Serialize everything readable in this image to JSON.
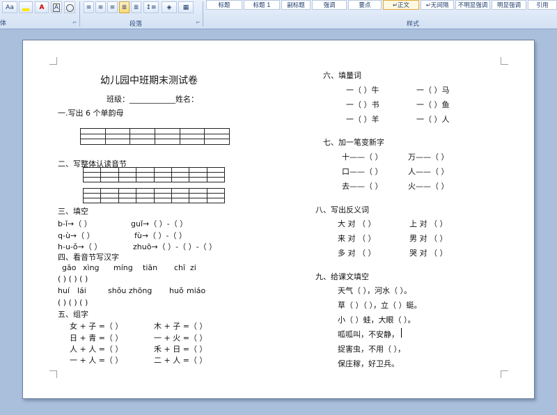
{
  "ribbon": {
    "font_size_btn": "Aa",
    "char_border": "A",
    "phonetic": "变",
    "paragraph_group": "段落",
    "styles_group": "样式",
    "font_group_tail": "体",
    "styles": [
      "标题",
      "标题 1",
      "副标题",
      "强调",
      "要点",
      "↵正文",
      "↵无间隔",
      "不明显强调",
      "明显强调",
      "引用"
    ]
  },
  "doc": {
    "title": "幼儿园中班期末测试卷",
    "class_line": "班级：____________姓名：",
    "s1": "一.写出 6 个单韵母",
    "s2": "二、写整体认读音节",
    "s3": "三、填空",
    "s3_rows": [
      [
        "b-ǐ→（          ）",
        "guǐ→（       ）-（     ）"
      ],
      [
        "q-ù→（          ）",
        "fù→（       ）-（      ）"
      ],
      [
        "h-u-ǒ→（        ）",
        "zhuō→（       ）-（     ）-（      ）"
      ]
    ],
    "s4": "四、看音节写汉字",
    "s4_py1": [
      "gāo",
      "xìng",
      "míng",
      "tiān",
      "chī",
      "zi"
    ],
    "s4_br1": "(                  )          (                 )         (                )",
    "s4_py2": [
      "huí",
      "lái",
      "shǒu zhōng",
      "huǒ",
      "miáo"
    ],
    "s4_br2": "(                 ) (                 )        (                 )",
    "s5": "五、组字",
    "s5_rows": [
      [
        "女 + 子 =（    ）",
        "木 + 子 =（    ）"
      ],
      [
        "日 + 青 =（    ）",
        "一 + 火 =（    ）"
      ],
      [
        "人 + 人 =（    ）",
        "禾 + 日 =（    ）"
      ],
      [
        "一 + 人 =（    ）",
        "二 + 人 =（    ）"
      ]
    ],
    "s6": "六、填量词",
    "s6_rows": [
      [
        "一（     ）牛",
        "一（     ）马"
      ],
      [
        "一（     ）书",
        "一（     ）鱼"
      ],
      [
        "一（     ）羊",
        "一（     ）人"
      ]
    ],
    "s7": "七、加一笔变新字",
    "s7_rows": [
      [
        "十——（     ）",
        "万——（     ）"
      ],
      [
        "口——（     ）",
        "人——（     ）"
      ],
      [
        "去——（     ）",
        "火——（     ）"
      ]
    ],
    "s8": "八、写出反义词",
    "s8_rows": [
      [
        "大 对 （       ）",
        "上 对 （       ）"
      ],
      [
        "来 对 （       ）",
        "男 对 （       ）"
      ],
      [
        "多 对 （       ）",
        "哭 对 （       ）"
      ]
    ],
    "s9": "九、给课文填空",
    "s9_lines": [
      "天气（         ），河水（       ）。",
      "草（       ）（       ），立（       ）蜓。",
      "小（       ）蛙，大眼（       ）。",
      "呱呱叫，不安静，",
      "捉害虫，不用（        ），",
      "保庄稼，好卫兵。"
    ]
  }
}
